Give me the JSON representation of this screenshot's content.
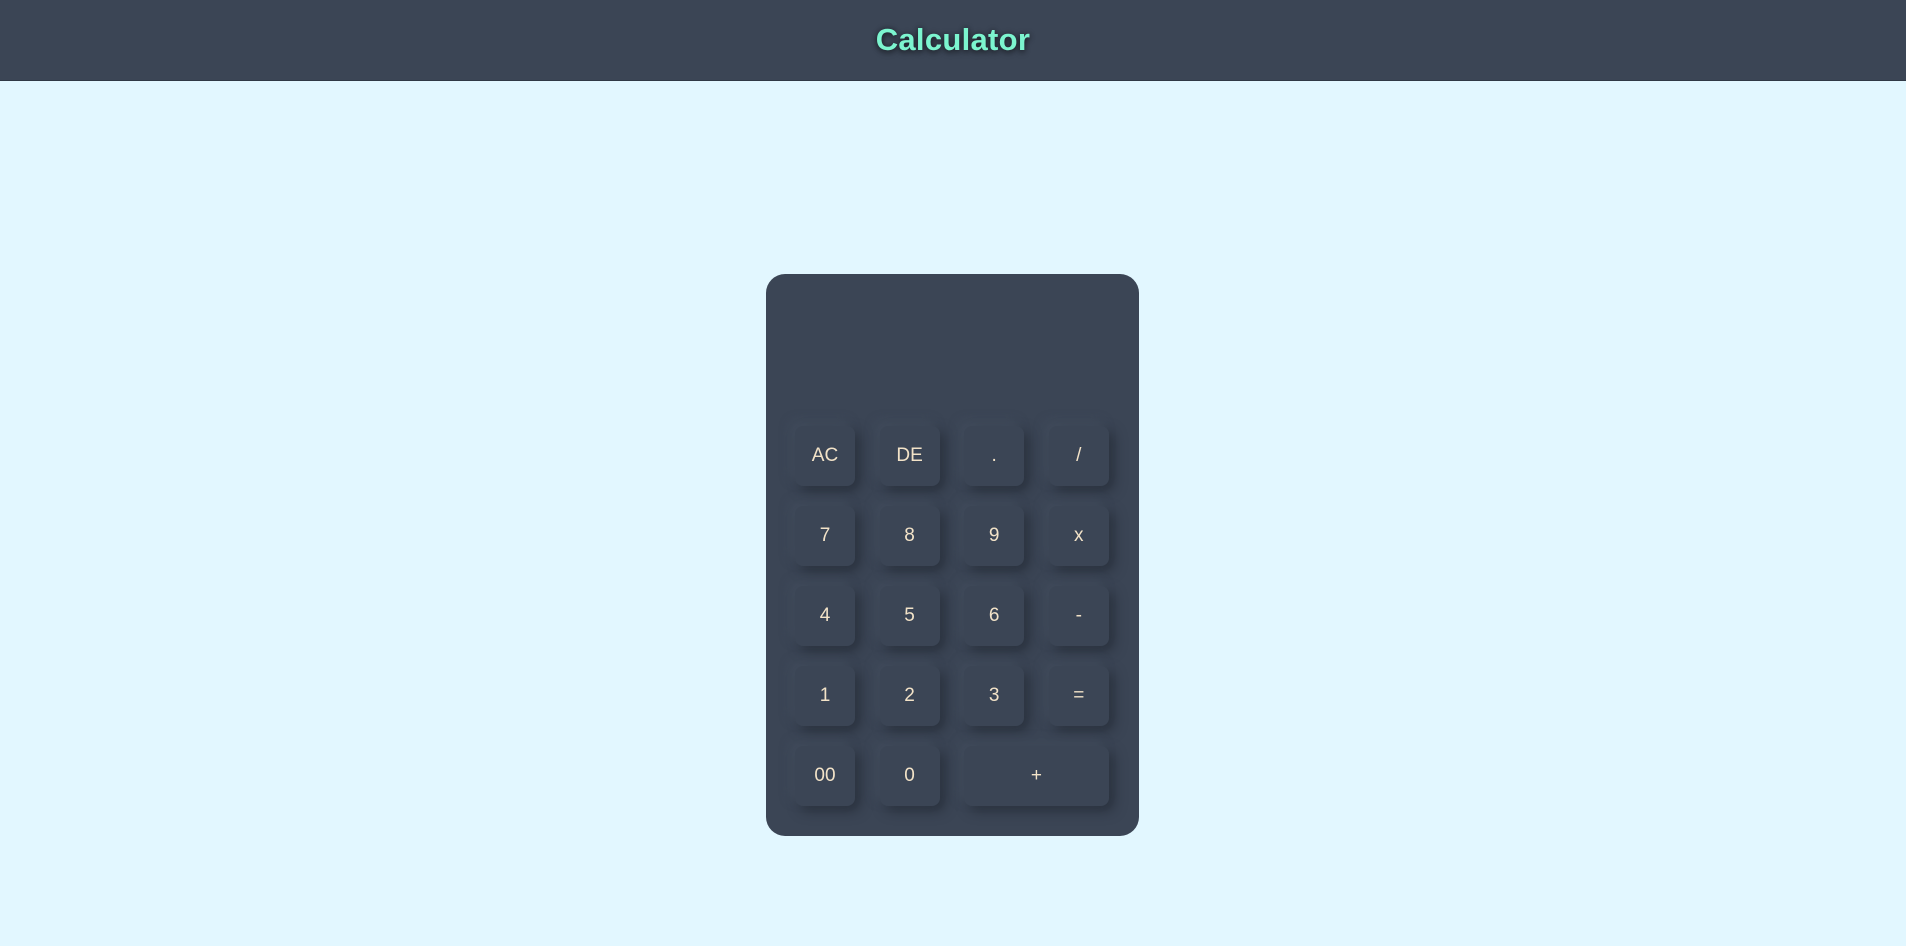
{
  "header": {
    "title": "Calculator"
  },
  "calculator": {
    "display_value": "",
    "keys": [
      {
        "label": "AC",
        "name": "all-clear-button"
      },
      {
        "label": "DE",
        "name": "delete-button"
      },
      {
        "label": ".",
        "name": "decimal-button"
      },
      {
        "label": "/",
        "name": "divide-button"
      },
      {
        "label": "7",
        "name": "digit-7-button"
      },
      {
        "label": "8",
        "name": "digit-8-button"
      },
      {
        "label": "9",
        "name": "digit-9-button"
      },
      {
        "label": "x",
        "name": "multiply-button"
      },
      {
        "label": "4",
        "name": "digit-4-button"
      },
      {
        "label": "5",
        "name": "digit-5-button"
      },
      {
        "label": "6",
        "name": "digit-6-button"
      },
      {
        "label": "-",
        "name": "subtract-button"
      },
      {
        "label": "1",
        "name": "digit-1-button"
      },
      {
        "label": "2",
        "name": "digit-2-button"
      },
      {
        "label": "3",
        "name": "digit-3-button"
      },
      {
        "label": "=",
        "name": "equals-button"
      },
      {
        "label": "00",
        "name": "double-zero-button"
      },
      {
        "label": "0",
        "name": "digit-0-button"
      },
      {
        "label": "+",
        "name": "add-button"
      }
    ]
  },
  "colors": {
    "page_background": "#e2f7ff",
    "panel_background": "#3b4555",
    "title_accent": "#7cf5cf",
    "key_text": "#f3e3c8"
  }
}
